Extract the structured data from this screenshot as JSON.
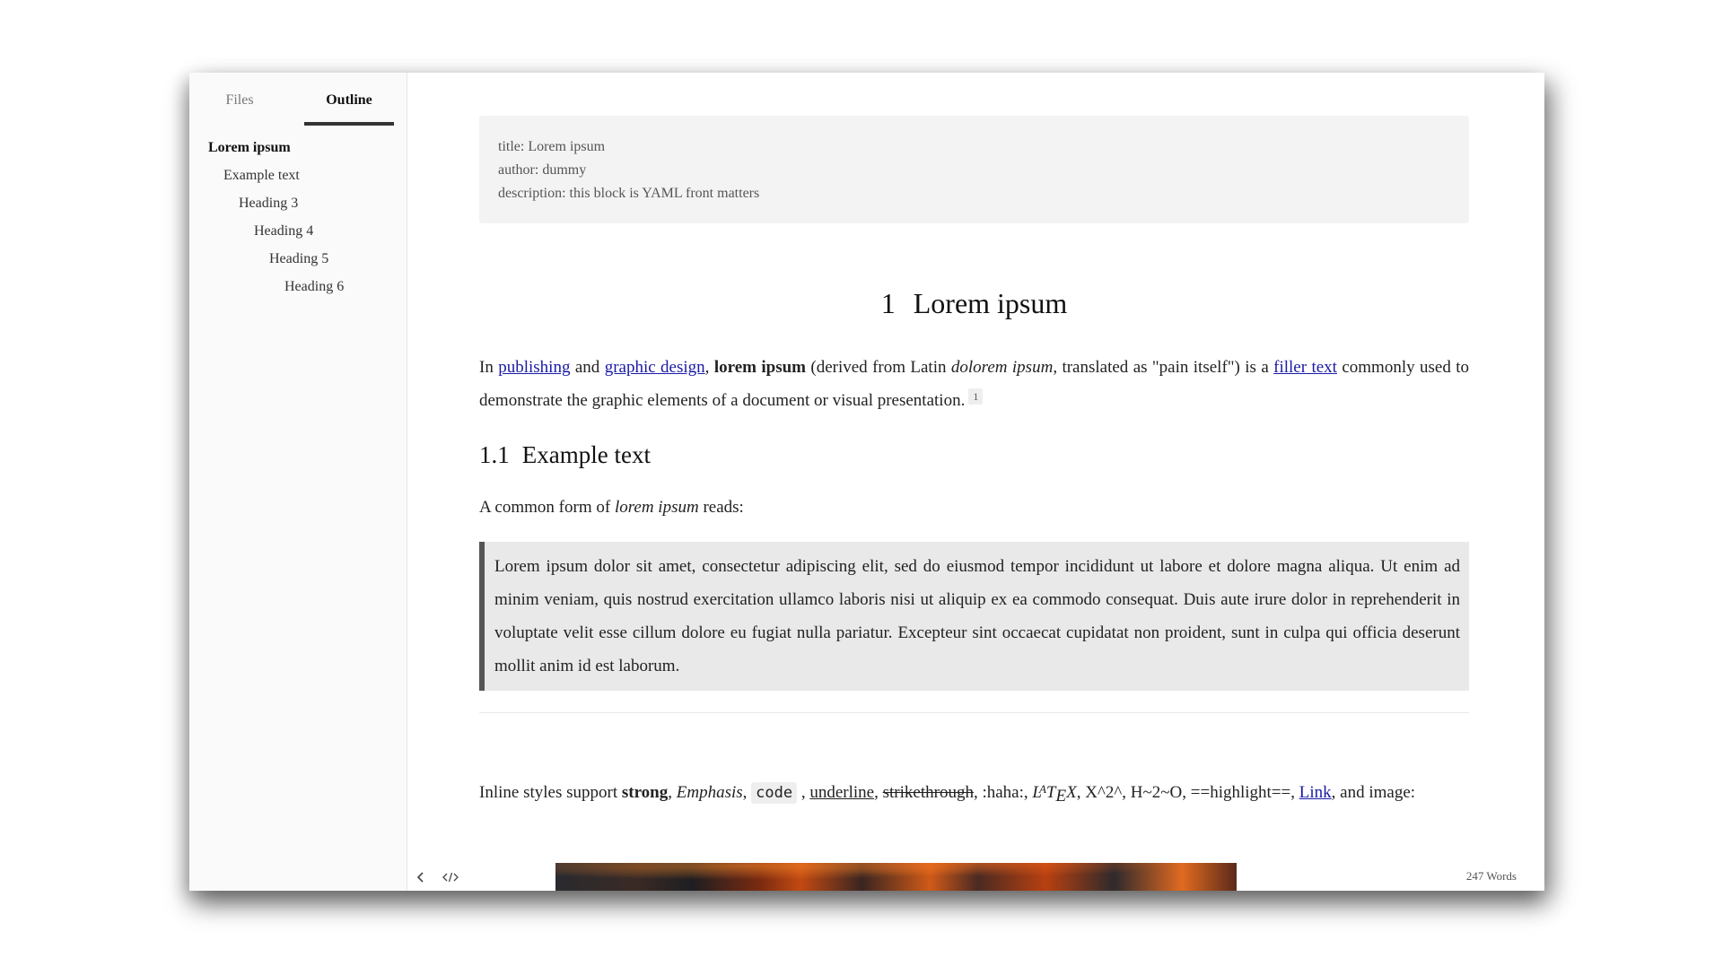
{
  "sidebar": {
    "tabs": [
      {
        "label": "Files",
        "active": false
      },
      {
        "label": "Outline",
        "active": true
      }
    ],
    "outline": [
      {
        "label": "Lorem ipsum",
        "level": 1
      },
      {
        "label": "Example text",
        "level": 2
      },
      {
        "label": "Heading 3",
        "level": 3
      },
      {
        "label": "Heading 4",
        "level": 4
      },
      {
        "label": "Heading 5",
        "level": 5
      },
      {
        "label": "Heading 6",
        "level": 6
      }
    ]
  },
  "frontmatter": {
    "lines": [
      "title: Lorem ipsum",
      "author: dummy",
      "description: this block is YAML front matters"
    ]
  },
  "doc": {
    "h1": {
      "number": "1",
      "text": "Lorem ipsum"
    },
    "p1": {
      "t1": "In ",
      "link1": "publishing",
      "t2": " and ",
      "link2": "graphic design",
      "t3": ", ",
      "bold": "lorem ipsum",
      "t4": " (derived from Latin ",
      "em": "dolorem ipsum",
      "t5": ", translated as \"pain itself\") is a ",
      "link3": "filler text",
      "t6": " commonly used to demonstrate the graphic elements of a document or visual presentation.",
      "footnote": "1"
    },
    "h2": {
      "number": "1.1",
      "text": "Example text"
    },
    "p2": {
      "t1": "A common form of ",
      "em": "lorem ipsum",
      "t2": " reads:"
    },
    "quote": "Lorem ipsum dolor sit amet, consectetur adipiscing elit, sed do eiusmod tempor incididunt ut labore et dolore magna aliqua. Ut enim ad minim veniam, quis nostrud exercitation ullamco laboris nisi ut aliquip ex ea commodo consequat. Duis aute irure dolor in reprehenderit in voluptate velit esse cillum dolore eu fugiat nulla pariatur. Excepteur sint occaecat cupidatat non proident, sunt in culpa qui officia deserunt mollit anim id est laborum.",
    "p3": {
      "t1": "Inline styles support ",
      "strong": "strong",
      "t2": ", ",
      "emphasis": "Emphasis",
      "t3": ", ",
      "code": "code",
      "t4": " , ",
      "underline": "underline",
      "t5": ", ",
      "strike": "strikethrough",
      "t6": ", :haha:, ",
      "latex": {
        "l": "L",
        "a": "A",
        "t": "T",
        "e": "E",
        "x": "X"
      },
      "t7": ", X^2^, H~2~O, ==highlight==, ",
      "link": "Link",
      "t8": ", and image:"
    }
  },
  "statusbar": {
    "word_count": "247 Words"
  },
  "icons": {
    "back": "chevron-left-icon",
    "source": "code-icon"
  }
}
